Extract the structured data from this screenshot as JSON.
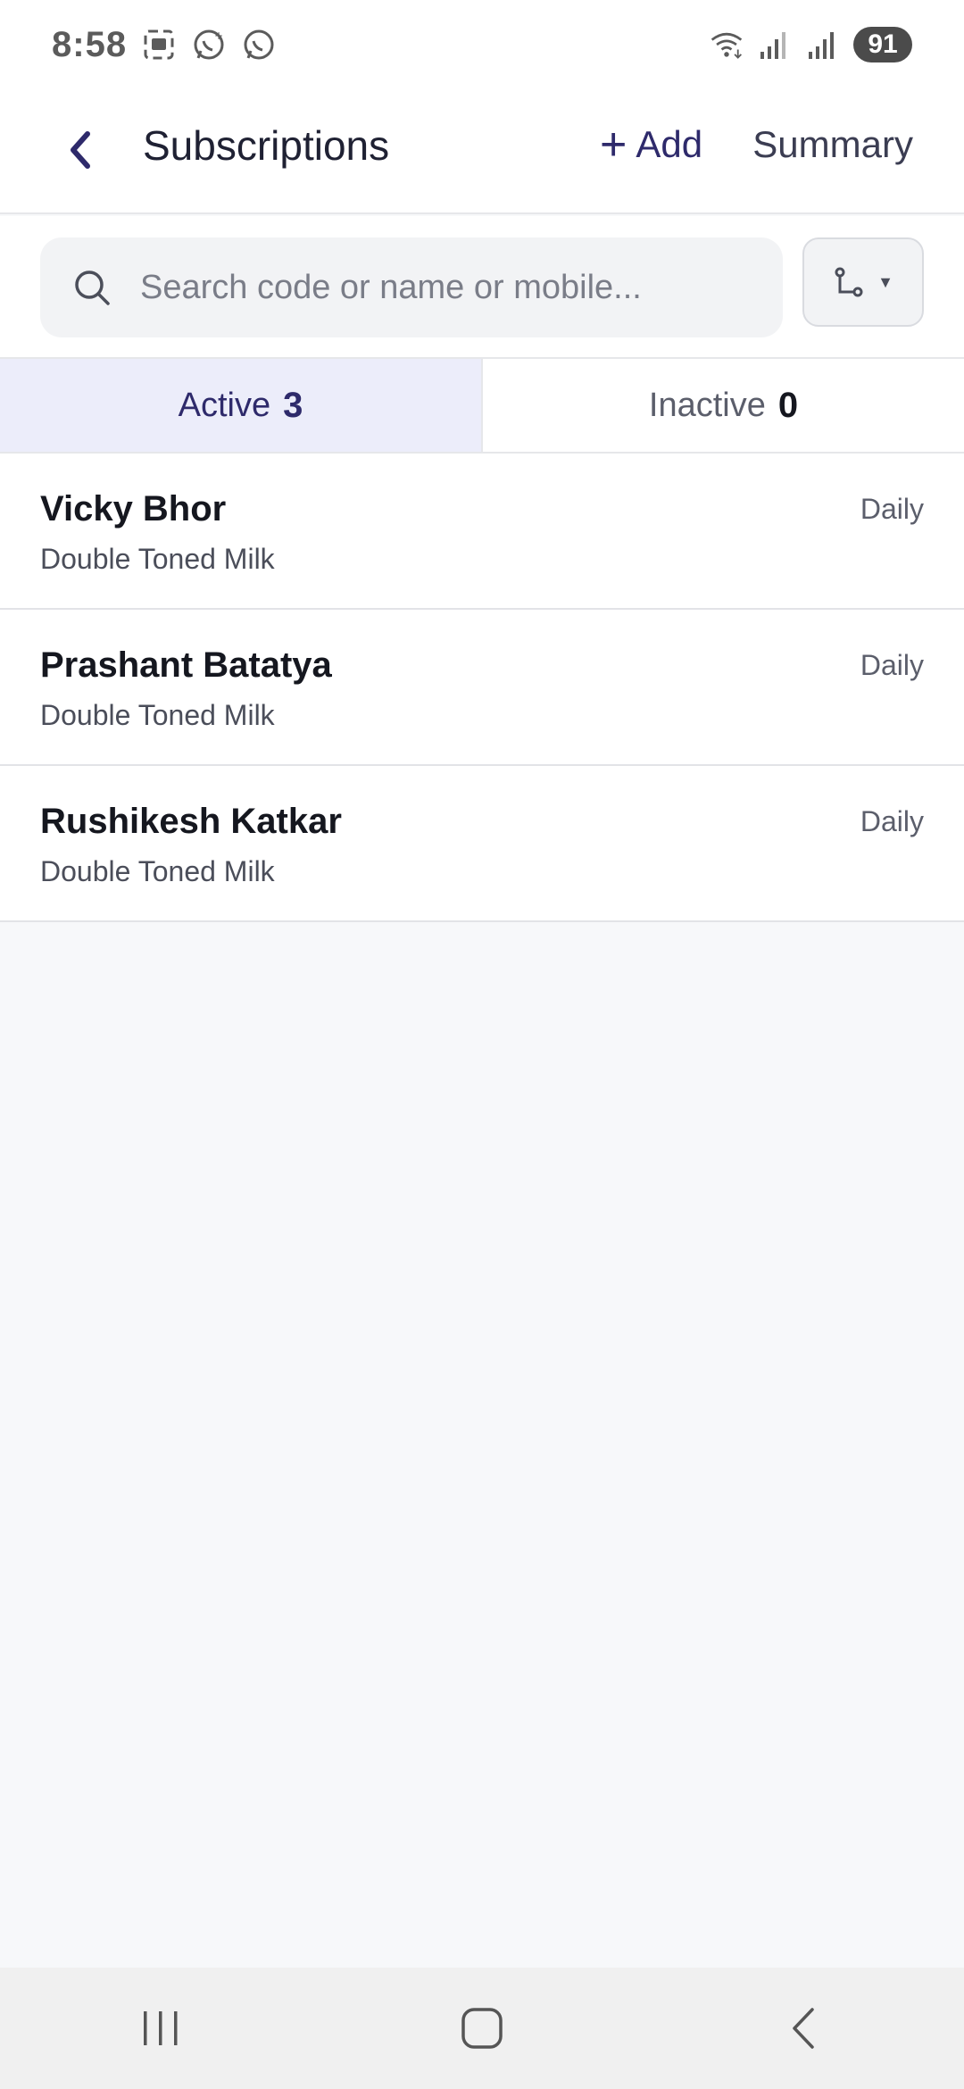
{
  "status_bar": {
    "time": "8:58",
    "battery": "91",
    "left_icons": [
      "screenshot-icon",
      "whatsapp-business-icon",
      "whatsapp-icon"
    ],
    "right_icons": [
      "wifi-icon",
      "signal-icon",
      "signal-icon"
    ]
  },
  "app_bar": {
    "title": "Subscriptions",
    "add_label": "Add",
    "add_icon": "+",
    "summary_label": "Summary"
  },
  "search": {
    "placeholder": "Search code or name or mobile...",
    "value": ""
  },
  "tabs": [
    {
      "label": "Active",
      "count": "3",
      "selected": true
    },
    {
      "label": "Inactive",
      "count": "0",
      "selected": false
    }
  ],
  "subscriptions": [
    {
      "name": "Vicky Bhor",
      "product": "Double Toned Milk",
      "frequency": "Daily"
    },
    {
      "name": "Prashant Batatya",
      "product": "Double Toned Milk",
      "frequency": "Daily"
    },
    {
      "name": "Rushikesh Katkar",
      "product": "Double Toned Milk",
      "frequency": "Daily"
    }
  ],
  "colors": {
    "accent": "#2e2a6b",
    "active_tab_bg": "#ecedfa",
    "background": "#f7f8fa"
  }
}
